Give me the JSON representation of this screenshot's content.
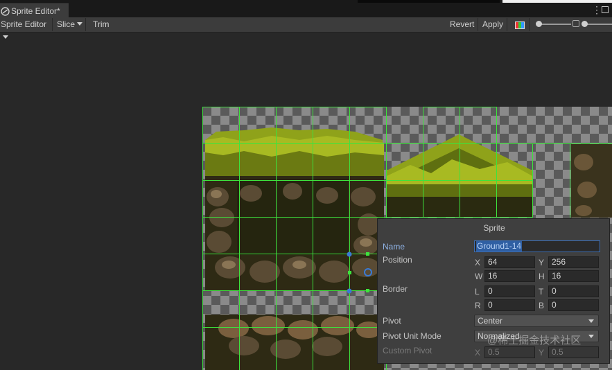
{
  "window": {
    "tab_title": "Sprite Editor*"
  },
  "toolbar": {
    "sprite_editor": "Sprite Editor",
    "slice": "Slice",
    "trim": "Trim",
    "revert": "Revert",
    "apply": "Apply"
  },
  "sprite_panel": {
    "title": "Sprite",
    "name_label": "Name",
    "name_value": "Ground1-14",
    "position_label": "Position",
    "x_label": "X",
    "x_value": "64",
    "y_label": "Y",
    "y_value": "256",
    "w_label": "W",
    "w_value": "16",
    "h_label": "H",
    "h_value": "16",
    "border_label": "Border",
    "l_label": "L",
    "l_value": "0",
    "t_label": "T",
    "t_value": "0",
    "r_label": "R",
    "r_value": "0",
    "b_label": "B",
    "b_value": "0",
    "pivot_label": "Pivot",
    "pivot_value": "Center",
    "pivot_unit_mode_label": "Pivot Unit Mode",
    "pivot_unit_mode_value": "Normalized",
    "custom_pivot_label": "Custom Pivot",
    "custom_x_label": "X",
    "custom_x_value": "0.5",
    "custom_y_label": "Y",
    "custom_y_value": "0.5"
  },
  "watermark": "@稀土掘金技术社区",
  "colors": {
    "slice_grid": "#3de33d",
    "handle": "#3a7bd5",
    "selection": "#2f5fa3",
    "grass": "#8fa21a",
    "dirt": "#4a3f2b"
  }
}
